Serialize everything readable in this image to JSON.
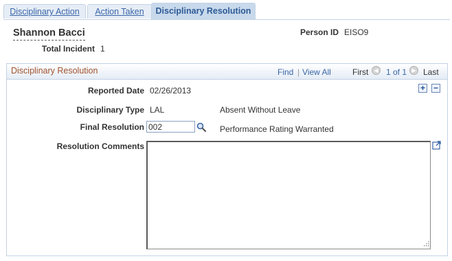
{
  "tabs": [
    {
      "label": "Disciplinary Action"
    },
    {
      "label": "Action Taken"
    },
    {
      "label": "Disciplinary Resolution"
    }
  ],
  "employee": {
    "name": "Shannon Bacci",
    "person_id_label": "Person ID",
    "person_id": "EISO9",
    "total_incident_label": "Total Incident",
    "total_incident": "1"
  },
  "section": {
    "title": "Disciplinary Resolution",
    "find": "Find",
    "separator": "|",
    "view_all": "View All",
    "first": "First",
    "counter": "1 of 1",
    "last": "Last"
  },
  "form": {
    "reported_date_label": "Reported Date",
    "reported_date": "02/26/2013",
    "disciplinary_type_label": "Disciplinary Type",
    "disciplinary_type": "LAL",
    "disciplinary_type_desc": "Absent Without Leave",
    "final_resolution_label": "Final Resolution",
    "final_resolution": "002",
    "final_resolution_desc": "Performance Rating Warranted",
    "resolution_comments_label": "Resolution Comments",
    "resolution_comments": ""
  },
  "icons": {
    "lookup": "magnifier-icon",
    "prev": "prev-arrow-icon",
    "next": "next-arrow-icon",
    "add": "plus-icon",
    "delete": "minus-icon",
    "expand": "expand-icon",
    "resize": "resize-grip-icon"
  },
  "colors": {
    "link": "#3a66a7",
    "section_title": "#a0522d",
    "tab_active_bg": "#c8d9ec",
    "tab_bg": "#e6edf6",
    "border": "#c3d2e4"
  }
}
